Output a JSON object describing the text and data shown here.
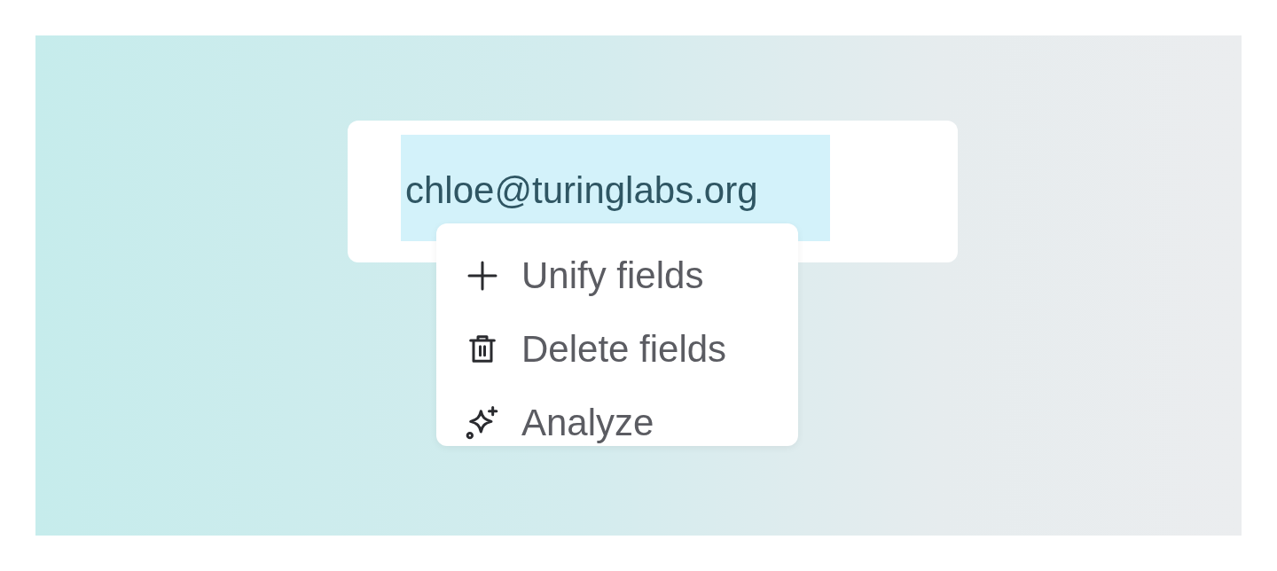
{
  "field": {
    "value": "chloe@turinglabs.org",
    "selected": true
  },
  "context_menu": {
    "items": [
      {
        "kind": "add",
        "label": "Unify fields"
      },
      {
        "kind": "delete",
        "label": "Delete fields"
      },
      {
        "kind": "analyze",
        "label": "Analyze"
      }
    ]
  }
}
